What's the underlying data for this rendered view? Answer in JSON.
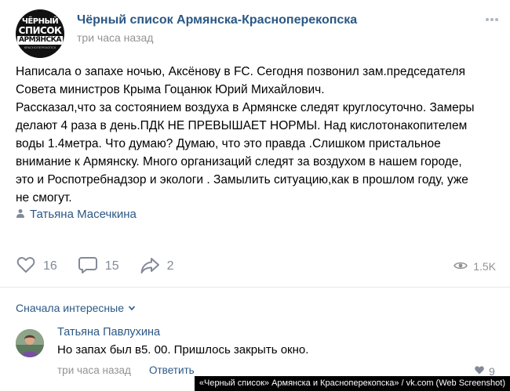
{
  "post": {
    "group_name": "Чёрный список Армянска-Красноперекопска",
    "time": "три часа назад",
    "avatar": {
      "line1": "ЧЁРНЫЙ",
      "line2": "СПИСОК",
      "line3": "АРМЯНСКА",
      "line4": "КРАСНОПЕРЕКОПСК"
    },
    "text_lines": [
      "Написала о запахе ночью, Аксёнову в FC. Сегодня позвонил зам.председателя",
      "Совета министров Крыма Гоцанюк Юрий Михайлович.",
      "Рассказал,что за состоянием воздуха в Армянске следят круглосуточно. Замеры",
      "делают 4 раза в день.ПДК НЕ ПРЕВЫШАЕТ НОРМЫ. Над кислотонакопителем",
      "воды 1.4метра. Что думаю? Думаю, что это правда .Слишком пристальное",
      "внимание к Армянску. Много организаций следят за воздухом в нашем городе,",
      "это и Роспотребнадзор и экологи . Замылить ситуацию,как в прошлом году, уже",
      "не смогут."
    ],
    "signer": "Татьяна Масечкина",
    "likes": "16",
    "comments": "15",
    "shares": "2",
    "views": "1.5K"
  },
  "comments_section": {
    "sort_label": "Сначала интересные",
    "comment": {
      "author": "Татьяна Павлухина",
      "text": "Но запах был в5. 00. Пришлось закрыть окно.",
      "time": "три часа назад",
      "reply_label": "Ответить",
      "likes": "9"
    }
  },
  "credit": "«Черный список» Армянска и Красноперекопска» / vk.com (Web Screenshot)",
  "colors": {
    "link": "#2a5885",
    "meta": "#939393",
    "icon": "#828a99"
  },
  "icons": [
    "more-icon",
    "user-icon",
    "heart-icon",
    "comment-icon",
    "share-icon",
    "eye-icon",
    "chevron-down-icon"
  ]
}
